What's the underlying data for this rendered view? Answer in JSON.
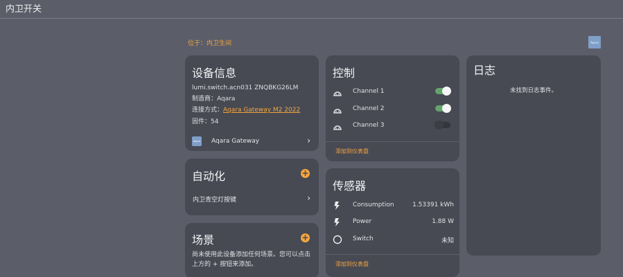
{
  "app": {
    "title": "内卫开关"
  },
  "location": "位于：内卫生间",
  "brand_badge": "Aqara",
  "device_info": {
    "title": "设备信息",
    "model_line": "lumi.switch.acn031 ZNQBKG26LM",
    "manufacturer": "制造商：Aqara",
    "connection_label": "连接方式：",
    "connection_link": "Aqara Gateway M2 2022",
    "firmware": "固件：54",
    "gateway_icon": "Aqara",
    "gateway_name": "Aqara Gateway"
  },
  "automation": {
    "title": "自动化",
    "items": [
      {
        "label": "内卫青空灯按键"
      }
    ]
  },
  "scene": {
    "title": "场景",
    "description": "尚未使用此设备添加任何场景。您可以点击上方的 + 按钮来添加。"
  },
  "control": {
    "title": "控制",
    "channels": [
      {
        "label": "Channel 1",
        "state": "on"
      },
      {
        "label": "Channel 2",
        "state": "on"
      },
      {
        "label": "Channel 3",
        "state": "off"
      }
    ],
    "add_to_dashboard": "添加到仪表盘"
  },
  "sensors": {
    "title": "传感器",
    "items": [
      {
        "label": "Consumption",
        "value": "1.53391 kWh",
        "icon": "flash-icon"
      },
      {
        "label": "Power",
        "value": "1.88 W",
        "icon": "flash-icon"
      },
      {
        "label": "Switch",
        "value": "未知",
        "icon": "circle-outline-icon"
      }
    ],
    "add_to_dashboard": "添加到仪表盘"
  },
  "log": {
    "title": "日志",
    "empty_text": "未找到日志事件。"
  },
  "colors": {
    "background": "#5b5d68",
    "card": "#474953",
    "accent": "#f4a640",
    "toggle_on": "#62a56a"
  }
}
